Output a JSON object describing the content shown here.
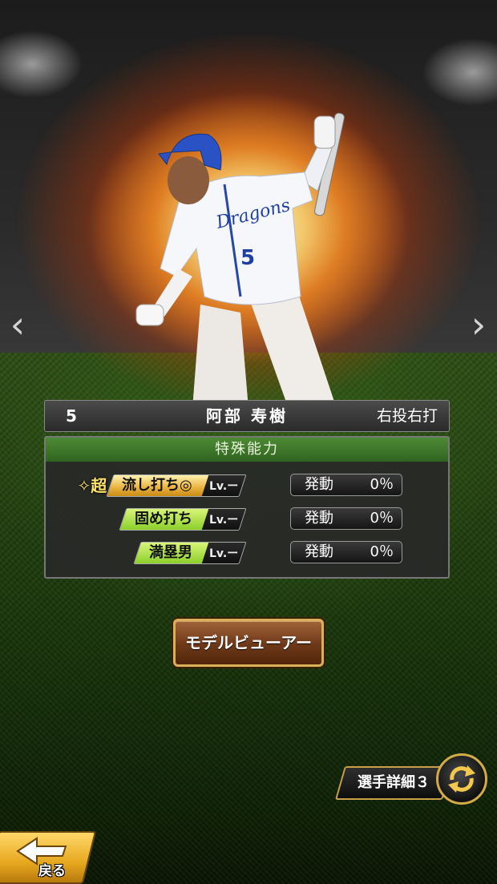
{
  "player": {
    "number": "5",
    "name": "阿部 寿樹",
    "throw_bat": "右投右打",
    "uniform_text": "Dragons",
    "uniform_number": "5"
  },
  "abilities": {
    "title": "特殊能力",
    "items": [
      {
        "super_label": "超",
        "name": "流し打ち◎",
        "level": "Lv.ー",
        "activation_label": "発動",
        "rate": "0％",
        "tier": "gold"
      },
      {
        "name": "固め打ち",
        "level": "Lv.ー",
        "activation_label": "発動",
        "rate": "0％",
        "tier": "green"
      },
      {
        "name": "満塁男",
        "level": "Lv.ー",
        "activation_label": "発動",
        "rate": "0％",
        "tier": "green"
      }
    ]
  },
  "buttons": {
    "model_viewer": "モデルビューアー",
    "player_detail": "選手詳細３",
    "back": "戻る"
  },
  "nav": {
    "prev": "‹",
    "next": "›"
  },
  "colors": {
    "accent_gold": "#d8b15a",
    "panel_header_green": "#3e7a2a",
    "skill_green": "#8ccf2a"
  }
}
